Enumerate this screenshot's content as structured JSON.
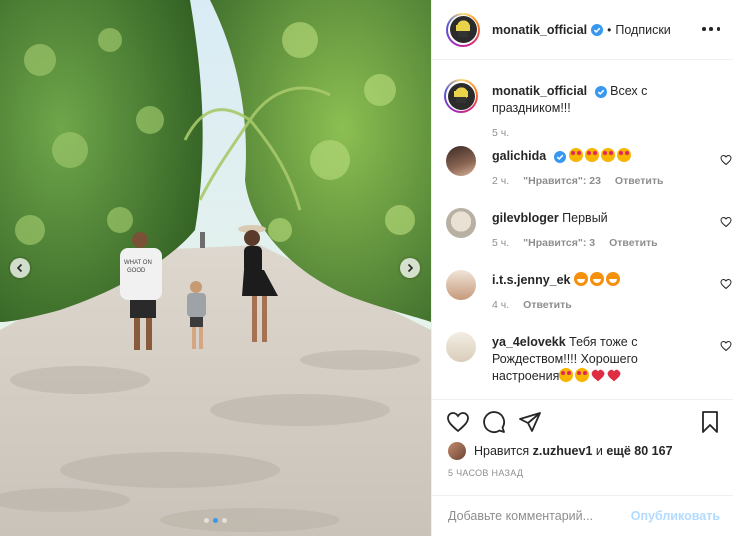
{
  "post": {
    "author": "monatik_official",
    "follow_label": "Подписки",
    "separator": "•",
    "more_label": "More options"
  },
  "carousel": {
    "slide_count": 3,
    "active_slide": 2,
    "shirt_text_1": "WHAT ON",
    "shirt_text_2": "GOOD"
  },
  "caption": {
    "username": "monatik_official",
    "text_line1": "Всех с",
    "text_line2": "праздником!!!",
    "time": "5 ч."
  },
  "comments": [
    {
      "username": "galichida",
      "verified": true,
      "text": "",
      "emojis": [
        "smile",
        "smile",
        "smile",
        "smile"
      ],
      "time": "2 ч.",
      "likes": "\"Нравится\": 23",
      "reply": "Ответить"
    },
    {
      "username": "gilevbloger",
      "verified": false,
      "text": "Первый",
      "emojis": [],
      "time": "5 ч.",
      "likes": "\"Нравится\": 3",
      "reply": "Ответить"
    },
    {
      "username": "i.t.s.jenny_ek",
      "verified": false,
      "text": "",
      "emojis": [
        "fox",
        "fox",
        "fox"
      ],
      "time": "4 ч.",
      "likes": "",
      "reply": "Ответить"
    },
    {
      "username": "ya_4elovekk",
      "verified": false,
      "text_line1": "Тебя тоже с",
      "text_line2": "Рождеством!!!! Хорошего",
      "text_line3": "настроения",
      "emojis": [
        "smile",
        "smile",
        "heart",
        "heart"
      ]
    }
  ],
  "likes": {
    "prefix": "Нравится",
    "user": "z.uzhuev1",
    "mid": "и",
    "count": "ещё 80 167"
  },
  "timestamp": "5 часов назад",
  "comment_box": {
    "placeholder": "Добавьте комментарий...",
    "publish_label": "Опубликовать"
  },
  "colors": {
    "accent": "#3897f0",
    "publish_disabled": "#b3dbff",
    "verified": "#3897f0",
    "text": "#262626",
    "muted": "#8e8e8e",
    "heart": "#ed4956"
  }
}
